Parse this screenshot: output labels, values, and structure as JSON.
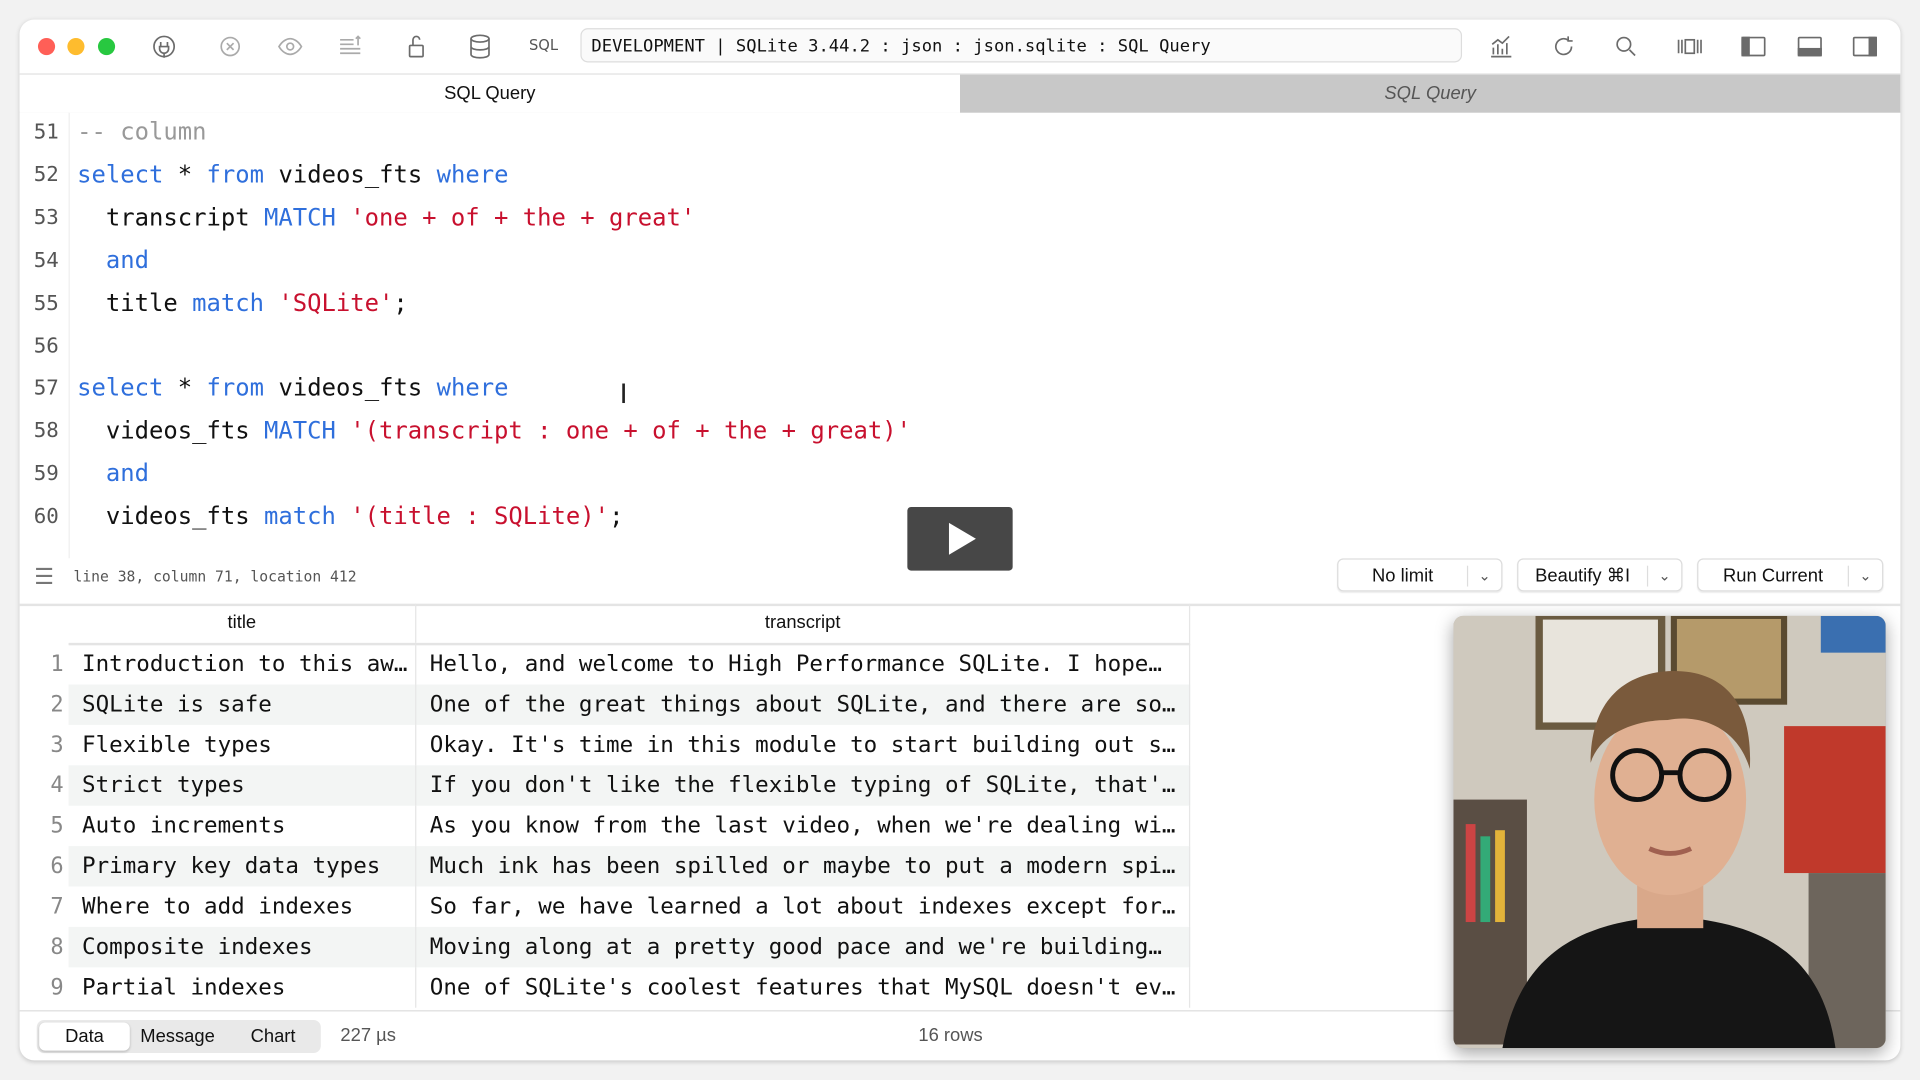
{
  "window": {
    "traffic_lights": {
      "close": "#ff5f57",
      "minimize": "#febc2e",
      "zoom": "#28c840"
    },
    "toolbar": {
      "icons": [
        "connection-plug-icon",
        "stop-icon",
        "preview-eye-icon",
        "export-lines-icon",
        "lock-icon",
        "database-icon",
        "chart-icon",
        "refresh-icon",
        "search-icon",
        "columns-icon",
        "left-panel-icon",
        "bottom-panel-icon",
        "right-panel-icon"
      ],
      "sql_label": "SQL",
      "connection_path": "DEVELOPMENT | SQLite 3.44.2 : json : json.sqlite : SQL Query"
    },
    "tabs": [
      {
        "label": "SQL Query",
        "active": true
      },
      {
        "label": "SQL Query",
        "active": false
      }
    ]
  },
  "editor": {
    "lines": [
      {
        "n": "51",
        "parts": [
          {
            "t": "-- column",
            "c": "cm"
          }
        ]
      },
      {
        "n": "52",
        "parts": [
          {
            "t": "select",
            "c": "kw"
          },
          {
            "t": " * ",
            "c": ""
          },
          {
            "t": "from",
            "c": "kw"
          },
          {
            "t": " videos_fts ",
            "c": ""
          },
          {
            "t": "where",
            "c": "kw"
          }
        ]
      },
      {
        "n": "53",
        "parts": [
          {
            "t": "  transcript ",
            "c": ""
          },
          {
            "t": "MATCH",
            "c": "kw"
          },
          {
            "t": " ",
            "c": ""
          },
          {
            "t": "'one + of + the + great'",
            "c": "str"
          }
        ]
      },
      {
        "n": "54",
        "parts": [
          {
            "t": "  ",
            "c": ""
          },
          {
            "t": "and",
            "c": "kw"
          }
        ]
      },
      {
        "n": "55",
        "parts": [
          {
            "t": "  title ",
            "c": ""
          },
          {
            "t": "match",
            "c": "kw"
          },
          {
            "t": " ",
            "c": ""
          },
          {
            "t": "'SQLite'",
            "c": "str"
          },
          {
            "t": ";",
            "c": ""
          }
        ]
      },
      {
        "n": "56",
        "parts": []
      },
      {
        "n": "57",
        "parts": [
          {
            "t": "select",
            "c": "kw"
          },
          {
            "t": " * ",
            "c": ""
          },
          {
            "t": "from",
            "c": "kw"
          },
          {
            "t": " videos_fts ",
            "c": ""
          },
          {
            "t": "where",
            "c": "kw"
          }
        ]
      },
      {
        "n": "58",
        "parts": [
          {
            "t": "  videos_fts ",
            "c": ""
          },
          {
            "t": "MATCH",
            "c": "kw"
          },
          {
            "t": " ",
            "c": ""
          },
          {
            "t": "'(transcript : one + of + the + great)'",
            "c": "str"
          }
        ]
      },
      {
        "n": "59",
        "parts": [
          {
            "t": "  ",
            "c": ""
          },
          {
            "t": "and",
            "c": "kw"
          }
        ]
      },
      {
        "n": "60",
        "parts": [
          {
            "t": "  videos_fts ",
            "c": ""
          },
          {
            "t": "match",
            "c": "kw"
          },
          {
            "t": " ",
            "c": ""
          },
          {
            "t": "'(title : SQLite)'",
            "c": "str"
          },
          {
            "t": ";",
            "c": ""
          }
        ]
      }
    ]
  },
  "status": {
    "cursor_info": "line 38, column 71, location 412",
    "limit": "No limit",
    "beautify": "Beautify ⌘I",
    "run": "Run Current"
  },
  "results": {
    "columns": [
      "title",
      "transcript"
    ],
    "rows": [
      {
        "n": "1",
        "title": "Introduction to this aw…",
        "transcript": "Hello, and welcome to High Performance SQLite. I hope…"
      },
      {
        "n": "2",
        "title": "SQLite is safe",
        "transcript": "One of the great things about SQLite, and there are so…"
      },
      {
        "n": "3",
        "title": "Flexible types",
        "transcript": "Okay. It's time in this module to start building out s…"
      },
      {
        "n": "4",
        "title": "Strict types",
        "transcript": "If you don't like the flexible typing of SQLite, that'…"
      },
      {
        "n": "5",
        "title": "Auto increments",
        "transcript": "As you know from the last video, when we're dealing wi…"
      },
      {
        "n": "6",
        "title": "Primary key data types",
        "transcript": "Much ink has been spilled or maybe to put a modern spi…"
      },
      {
        "n": "7",
        "title": "Where to add indexes",
        "transcript": "So far, we have learned a lot about indexes except for…"
      },
      {
        "n": "8",
        "title": "Composite indexes",
        "transcript": "Moving along at a pretty good pace and we're building…"
      },
      {
        "n": "9",
        "title": "Partial indexes",
        "transcript": "One of SQLite's coolest features that MySQL doesn't ev…"
      }
    ]
  },
  "footer": {
    "tabs": [
      "Data",
      "Message",
      "Chart"
    ],
    "active_tab": "Data",
    "elapsed": "227 µs",
    "row_count": "16 rows"
  }
}
